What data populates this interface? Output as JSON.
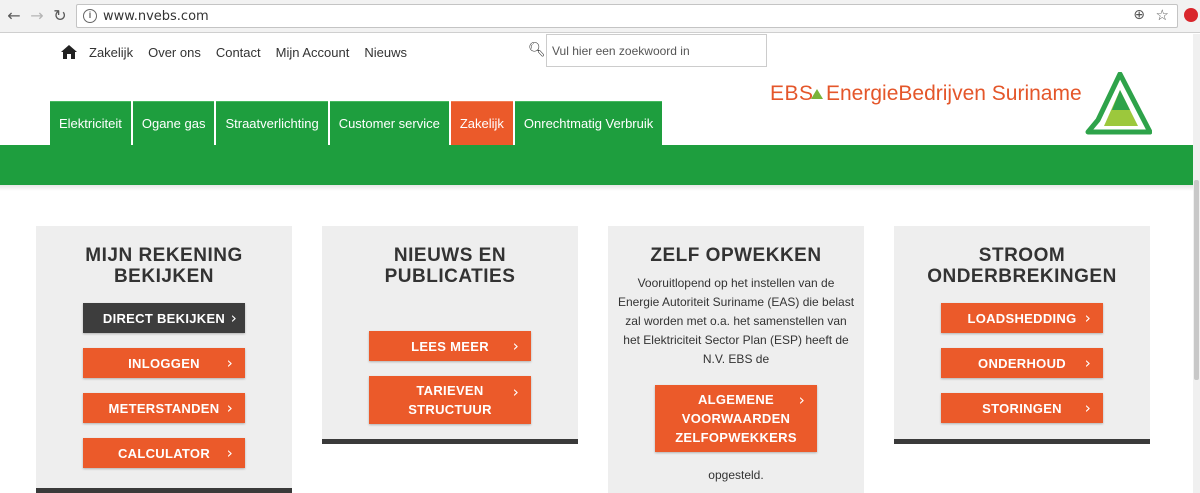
{
  "browser": {
    "url": "www.nvebs.com",
    "back_icon": "arrow-left-icon",
    "forward_icon": "arrow-right-icon",
    "reload_icon": "reload-icon"
  },
  "topnav": {
    "items": [
      "Zakelijk",
      "Over ons",
      "Contact",
      "Mijn Account",
      "Nieuws"
    ]
  },
  "search": {
    "placeholder": "Vul hier een zoekwoord in"
  },
  "logo": {
    "ebs": "EBS",
    "name": "EnergieBedrijven Suriname"
  },
  "tabs": [
    {
      "label": "Elektriciteit",
      "active": false
    },
    {
      "label": "Ogane gas",
      "active": false
    },
    {
      "label": "Straatverlichting",
      "active": false
    },
    {
      "label": "Customer service",
      "active": false
    },
    {
      "label": "Zakelijk",
      "active": true
    },
    {
      "label": "Onrechtmatig Verbruik",
      "active": false
    }
  ],
  "colors": {
    "green": "#1e9e3e",
    "orange": "#eb5a2a",
    "dark": "#3d3d3d",
    "card_bg": "#eeeeee"
  },
  "cards": {
    "rekening": {
      "title_line1": "MIJN REKENING",
      "title_line2": "BEKIJKEN",
      "buttons": [
        "DIRECT BEKIJKEN",
        "INLOGGEN",
        "METERSTANDEN",
        "CALCULATOR"
      ]
    },
    "nieuws": {
      "title_line1": "NIEUWS EN",
      "title_line2": "PUBLICATIES",
      "buttons": [
        "LEES MEER",
        "TARIEVEN",
        "STRUCTUUR"
      ]
    },
    "zelf": {
      "title": "ZELF OPWEKKEN",
      "paragraph": "Vooruitlopend op het instellen van de Energie Autoriteit Suriname (EAS) die belast zal worden met o.a. het samenstellen van het Elektriciteit Sector Plan (ESP) heeft de N.V. EBS de",
      "button_lines": [
        "ALGEMENE",
        "VOORWAARDEN",
        "ZELFOPWEKKERS"
      ],
      "after": "opgesteld."
    },
    "stroom": {
      "title_line1": "STROOM",
      "title_line2": "ONDERBREKINGEN",
      "buttons": [
        "LOADSHEDDING",
        "ONDERHOUD",
        "STORINGEN"
      ]
    }
  }
}
